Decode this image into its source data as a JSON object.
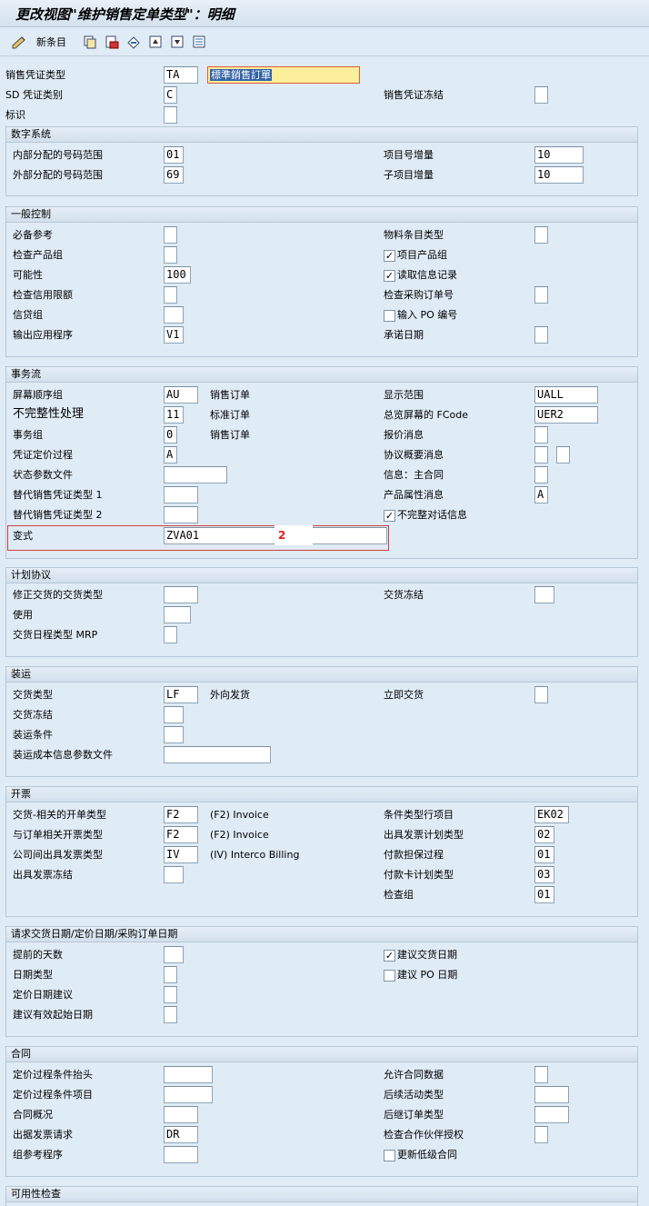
{
  "title": "更改视图\"维护销售定单类型\"：明细",
  "toolbar": {
    "new_entries": "新条目"
  },
  "header": {
    "doc_type_label": "销售凭证类型",
    "doc_type_value": "TA",
    "doc_type_desc": "標準銷售訂單",
    "sd_cat_label": "SD 凭证类别",
    "sd_cat_value": "C",
    "block_label": "销售凭证冻结",
    "indicator_label": "标识"
  },
  "number": {
    "title": "数字系统",
    "internal_label": "内部分配的号码范围",
    "internal_value": "01",
    "external_label": "外部分配的号码范围",
    "external_value": "69",
    "item_incr_label": "项目号增量",
    "item_incr_value": "10",
    "sub_incr_label": "子项目增量",
    "sub_incr_value": "10"
  },
  "general": {
    "title": "一般控制",
    "ref_mand_label": "必备参考",
    "check_div_label": "检查产品组",
    "prob_label": "可能性",
    "prob_value": "100",
    "check_credit_label": "检查信用限额",
    "credit_group_label": "信贷组",
    "output_app_label": "输出应用程序",
    "output_app_value": "V1",
    "mat_entry_label": "物料条目类型",
    "item_div_label": "项目产品组",
    "item_div_checked": true,
    "read_info_label": "读取信息记录",
    "read_info_checked": true,
    "check_po_label": "检查采购订单号",
    "enter_po_label": "输入 PO 编号",
    "enter_po_checked": false,
    "commit_date_label": "承诺日期"
  },
  "transaction": {
    "title": "事务流",
    "screen_seq_label": "屏幕顺序组",
    "screen_seq_value": "AU",
    "screen_seq_desc": "销售订单",
    "incomplete_label": "不完整性处理",
    "incomplete_value": "11",
    "incomplete_desc": "标准订单",
    "trans_group_label": "事务组",
    "trans_group_value": "0",
    "trans_group_desc": "销售订单",
    "doc_pricing_label": "凭证定价过程",
    "doc_pricing_value": "A",
    "status_profile_label": "状态参数文件",
    "alt_type1_label": "替代销售凭证类型 1",
    "alt_type2_label": "替代销售凭证类型 2",
    "variant_label": "变式",
    "variant_value": "ZVA01",
    "variant_marker": "2",
    "display_range_label": "显示范围",
    "display_range_value": "UALL",
    "fcode_label": "总览屏幕的 FCode",
    "fcode_value": "UER2",
    "quot_msg_label": "报价消息",
    "outline_msg_label": "协议概要消息",
    "info_contract_label": "信息：主合同",
    "prod_attr_label": "产品属性消息",
    "prod_attr_value": "A",
    "incomp_dialog_label": "不完整对话信息",
    "incomp_dialog_checked": true
  },
  "scheduling": {
    "title": "计划协议",
    "corr_deliv_label": "修正交货的交货类型",
    "usage_label": "使用",
    "mrp_label": "交货日程类型 MRP",
    "deliv_block_label": "交货冻结"
  },
  "shipping": {
    "title": "装运",
    "deliv_type_label": "交货类型",
    "deliv_type_value": "LF",
    "deliv_type_desc": "外向发货",
    "deliv_block_label": "交货冻结",
    "ship_cond_label": "装运条件",
    "ship_cost_label": "装运成本信息参数文件",
    "immediate_label": "立即交货"
  },
  "billing": {
    "title": "开票",
    "deliv_bill_label": "交货-相关的开单类型",
    "deliv_bill_value": "F2",
    "deliv_bill_desc": "(F2) Invoice",
    "order_bill_label": "与订单相关开票类型",
    "order_bill_value": "F2",
    "order_bill_desc": "(F2) Invoice",
    "interco_label": "公司间出具发票类型",
    "interco_value": "IV",
    "interco_desc": "(IV) Interco Billing",
    "bill_block_label": "出具发票冻结",
    "cond_type_label": "条件类型行项目",
    "cond_type_value": "EK02",
    "bill_plan_label": "出具发票计划类型",
    "bill_plan_value": "02",
    "pay_guar_label": "付款担保过程",
    "pay_guar_value": "01",
    "card_plan_label": "付款卡计划类型",
    "card_plan_value": "03",
    "check_group_label": "检查组",
    "check_group_value": "01"
  },
  "dates": {
    "title": "请求交货日期/定价日期/采购订单日期",
    "lead_days_label": "提前的天数",
    "date_type_label": "日期类型",
    "pricing_prop_label": "定价日期建议",
    "valid_from_label": "建议有效起始日期",
    "prop_deliv_label": "建议交货日期",
    "prop_deliv_checked": true,
    "prop_po_label": "建议 PO 日期",
    "prop_po_checked": false
  },
  "contract": {
    "title": "合同",
    "pricing_header_label": "定价过程条件抬头",
    "pricing_item_label": "定价过程条件项目",
    "contract_profile_label": "合同概况",
    "billing_req_label": "出据发票请求",
    "billing_req_value": "DR",
    "group_ref_label": "组参考程序",
    "contract_data_label": "允许合同数据",
    "follow_act_label": "后续活动类型",
    "subseq_order_label": "后继订单类型",
    "check_partner_label": "检查合作伙伴授权",
    "update_lower_label": "更新低级合同",
    "update_lower_checked": false
  },
  "availability": {
    "title": "可用性检查"
  }
}
